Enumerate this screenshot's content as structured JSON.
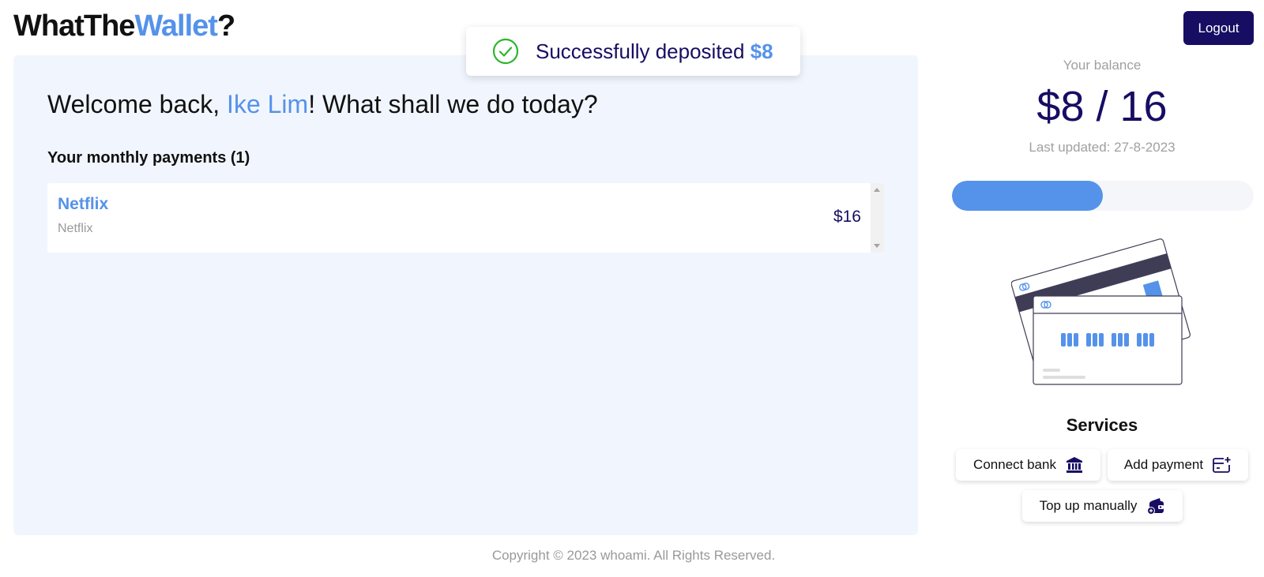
{
  "header": {
    "logo_part1": "WhatThe",
    "logo_part2": "Wallet",
    "logo_part3": "?",
    "logout_label": "Logout"
  },
  "toast": {
    "message": "Successfully deposited",
    "amount": "$8",
    "icon": "check-circle-icon"
  },
  "main": {
    "welcome_prefix": "Welcome back, ",
    "user_name": "Ike Lim",
    "welcome_suffix": "! What shall we do today?",
    "payments_heading": "Your monthly payments (1)",
    "payments": [
      {
        "name": "Netflix",
        "description": "Netflix",
        "amount": "$16"
      }
    ]
  },
  "sidebar": {
    "balance_label": "Your balance",
    "balance_value": "$8 / 16",
    "last_updated": "Last updated: 27-8-2023",
    "progress_fraction": 0.5,
    "services_title": "Services",
    "services": {
      "connect_bank": {
        "label": "Connect bank",
        "icon": "bank-icon"
      },
      "add_payment": {
        "label": "Add payment",
        "icon": "add-card-icon"
      },
      "top_up": {
        "label": "Top up manually",
        "icon": "wallet-icon"
      }
    }
  },
  "footer": {
    "copyright": "Copyright © 2023 whoami. All Rights Reserved."
  },
  "colors": {
    "accent": "#5592ea",
    "primary_dark": "#170d63",
    "panel_bg": "#f1f6fe",
    "success": "#2db52d"
  }
}
